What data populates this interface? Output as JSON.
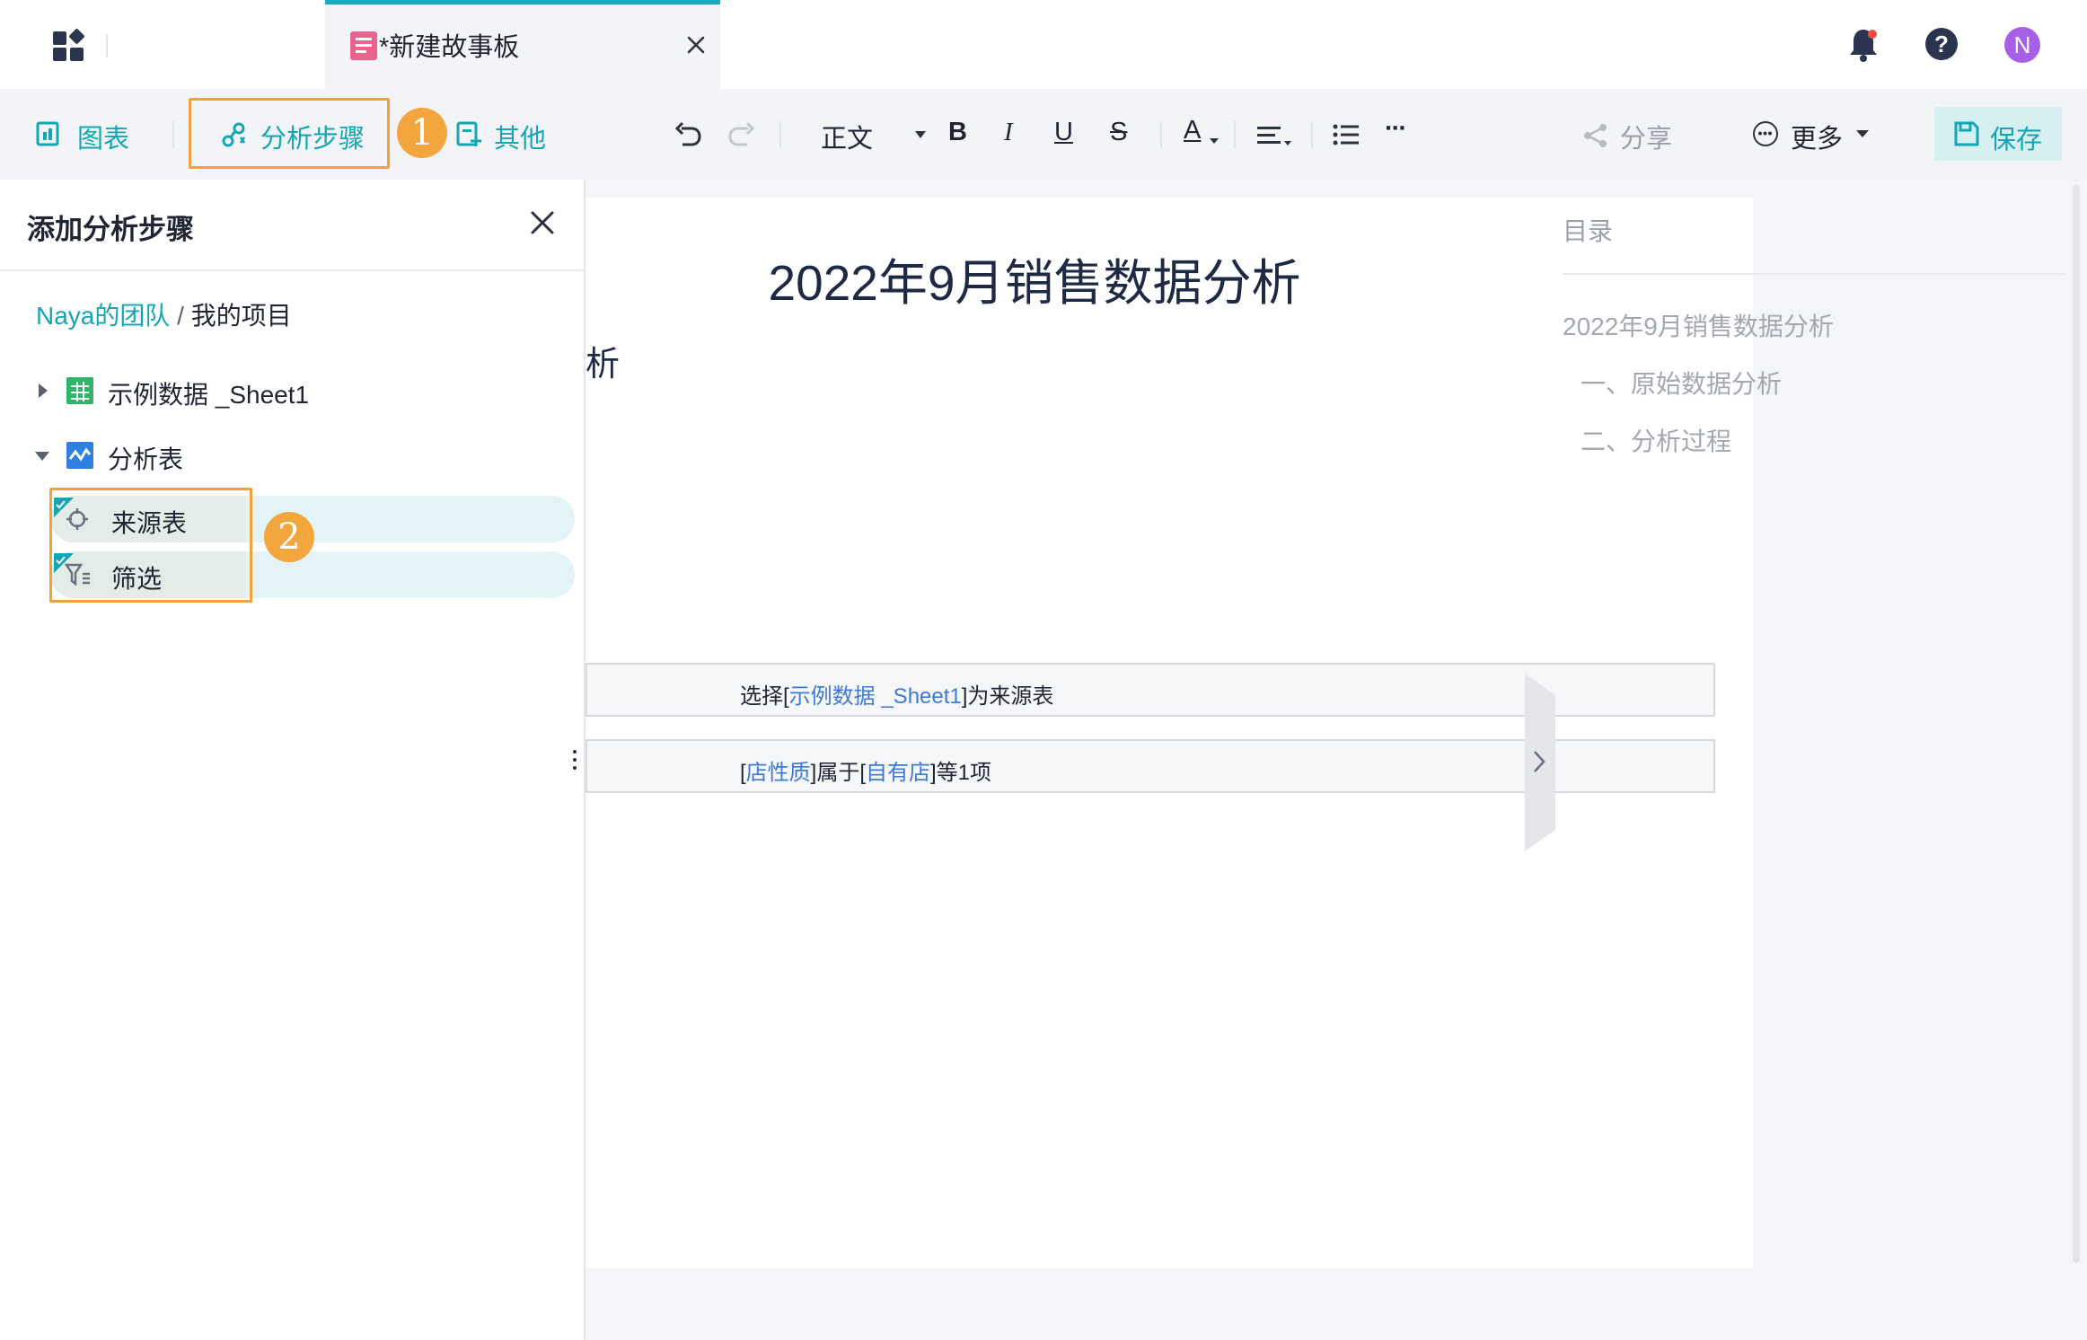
{
  "header": {
    "tab_title": "*新建故事板",
    "avatar_initial": "N"
  },
  "toolbar": {
    "chart_label": "图表",
    "analysis_steps_label": "分析步骤",
    "other_label": "其他",
    "text_style_value": "正文",
    "bold_label": "B",
    "italic_label": "I",
    "underline_label": "U",
    "strike_label": "S",
    "font_color_label": "A",
    "more_dots": "···",
    "share_label": "分享",
    "more_label": "更多",
    "save_label": "保存"
  },
  "annotations": {
    "badge_1": "1",
    "badge_2": "2"
  },
  "panel": {
    "title": "添加分析步骤",
    "breadcrumb_team": "Naya的团队",
    "breadcrumb_sep": "/",
    "breadcrumb_project": "我的项目",
    "tree": [
      {
        "label": "示例数据 _Sheet1"
      },
      {
        "label": "分析表"
      }
    ],
    "steps": [
      {
        "label": "来源表"
      },
      {
        "label": "筛选"
      }
    ]
  },
  "document": {
    "title": "2022年9月销售数据分析",
    "partial_heading": "析",
    "step1": {
      "prefix": "选择[",
      "link": "示例数据 _Sheet1",
      "suffix": "]为来源表"
    },
    "step2": {
      "open": "[",
      "field": "店性质",
      "middle": "]属于[",
      "value": "自有店",
      "suffix": "]等1项"
    }
  },
  "toc": {
    "title": "目录",
    "items": [
      {
        "label": "2022年9月销售数据分析"
      },
      {
        "label": "一、原始数据分析"
      },
      {
        "label": "二、分析过程"
      }
    ]
  },
  "colors": {
    "accent": "#14a6b4",
    "highlight": "#f2a23a",
    "link": "#3e79d6",
    "avatar": "#a75fe8"
  }
}
